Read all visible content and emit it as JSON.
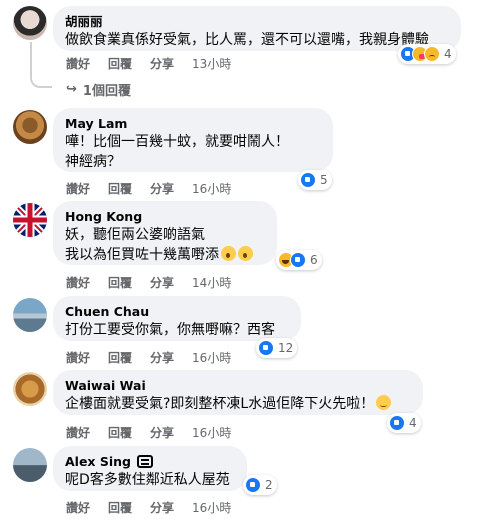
{
  "actions": {
    "like": "讚好",
    "reply": "回覆",
    "share": "分享"
  },
  "comments": [
    {
      "author": "胡丽丽",
      "text": "做飲食業真係好受氣，比人罵，還不可以還嘴，我親身體驗",
      "time": "13小時",
      "reactions": {
        "icons": [
          "like-icon",
          "care-icon",
          "sad-icon"
        ],
        "count": "4"
      },
      "replies_label": "1個回覆"
    },
    {
      "author": "May Lam",
      "text_line1": "嘩！比個一百幾十蚊",
      "text_line1_tail": "，就要咁鬧人！",
      "text_line2": "神經病？",
      "time": "16小時",
      "reactions": {
        "icons": [
          "like-icon"
        ],
        "count": "5"
      }
    },
    {
      "author": "Hong Kong",
      "text_line1": "妖，聽佢兩公婆啲語氣",
      "text_line2": "我以為佢買咗十幾萬嘢添",
      "time": "14小時",
      "reactions": {
        "icons": [
          "haha-icon",
          "like-icon"
        ],
        "count": "6"
      }
    },
    {
      "author": "Chuen Chau",
      "text": "打份工要受你氣，你無嘢嘛？西客",
      "time": "16小時",
      "reactions": {
        "icons": [
          "like-icon"
        ],
        "count": "12"
      }
    },
    {
      "author": "Waiwai Wai",
      "text": "企樓面就要受氣?即刻整杯凍L水過佢降下火先啦！",
      "time": "16小時",
      "reactions": {
        "icons": [
          "like-icon"
        ],
        "count": "4"
      }
    },
    {
      "author": "Alex Sing",
      "text": "呢D客多數住鄰近私人屋苑",
      "time": "16小時",
      "reactions": {
        "icons": [
          "like-icon"
        ],
        "count": "2"
      }
    }
  ],
  "colors": {
    "bubble": "#f0f2f5",
    "muted": "#65676b",
    "like": "#1877f2",
    "text": "#050505"
  }
}
